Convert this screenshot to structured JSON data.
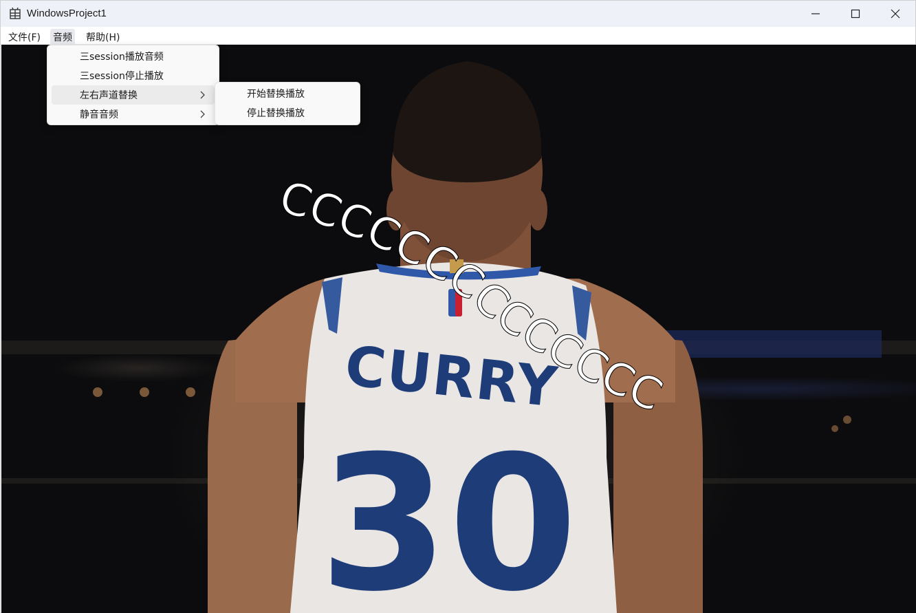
{
  "window": {
    "title": "WindowsProject1"
  },
  "menubar": {
    "items": [
      {
        "label": "文件(F)"
      },
      {
        "label": "音频"
      },
      {
        "label": "帮助(H)"
      }
    ]
  },
  "audio_menu": {
    "items": [
      {
        "label": "三session播放音频",
        "has_submenu": false
      },
      {
        "label": "三session停止播放",
        "has_submenu": false
      },
      {
        "label": "左右声道替换",
        "has_submenu": true
      },
      {
        "label": "静音音频",
        "has_submenu": true
      }
    ]
  },
  "swap_submenu": {
    "items": [
      {
        "label": "开始替换播放"
      },
      {
        "label": "停止替换播放"
      }
    ]
  },
  "overlay": {
    "text": "CCCCCCCCCCCCCCC"
  },
  "photo": {
    "jersey_name": "CURRY",
    "jersey_number": "30"
  },
  "colors": {
    "titlebar": "#eef2f8",
    "jersey_blue": "#1d3c78",
    "menu_bg": "#f9f9f9"
  }
}
